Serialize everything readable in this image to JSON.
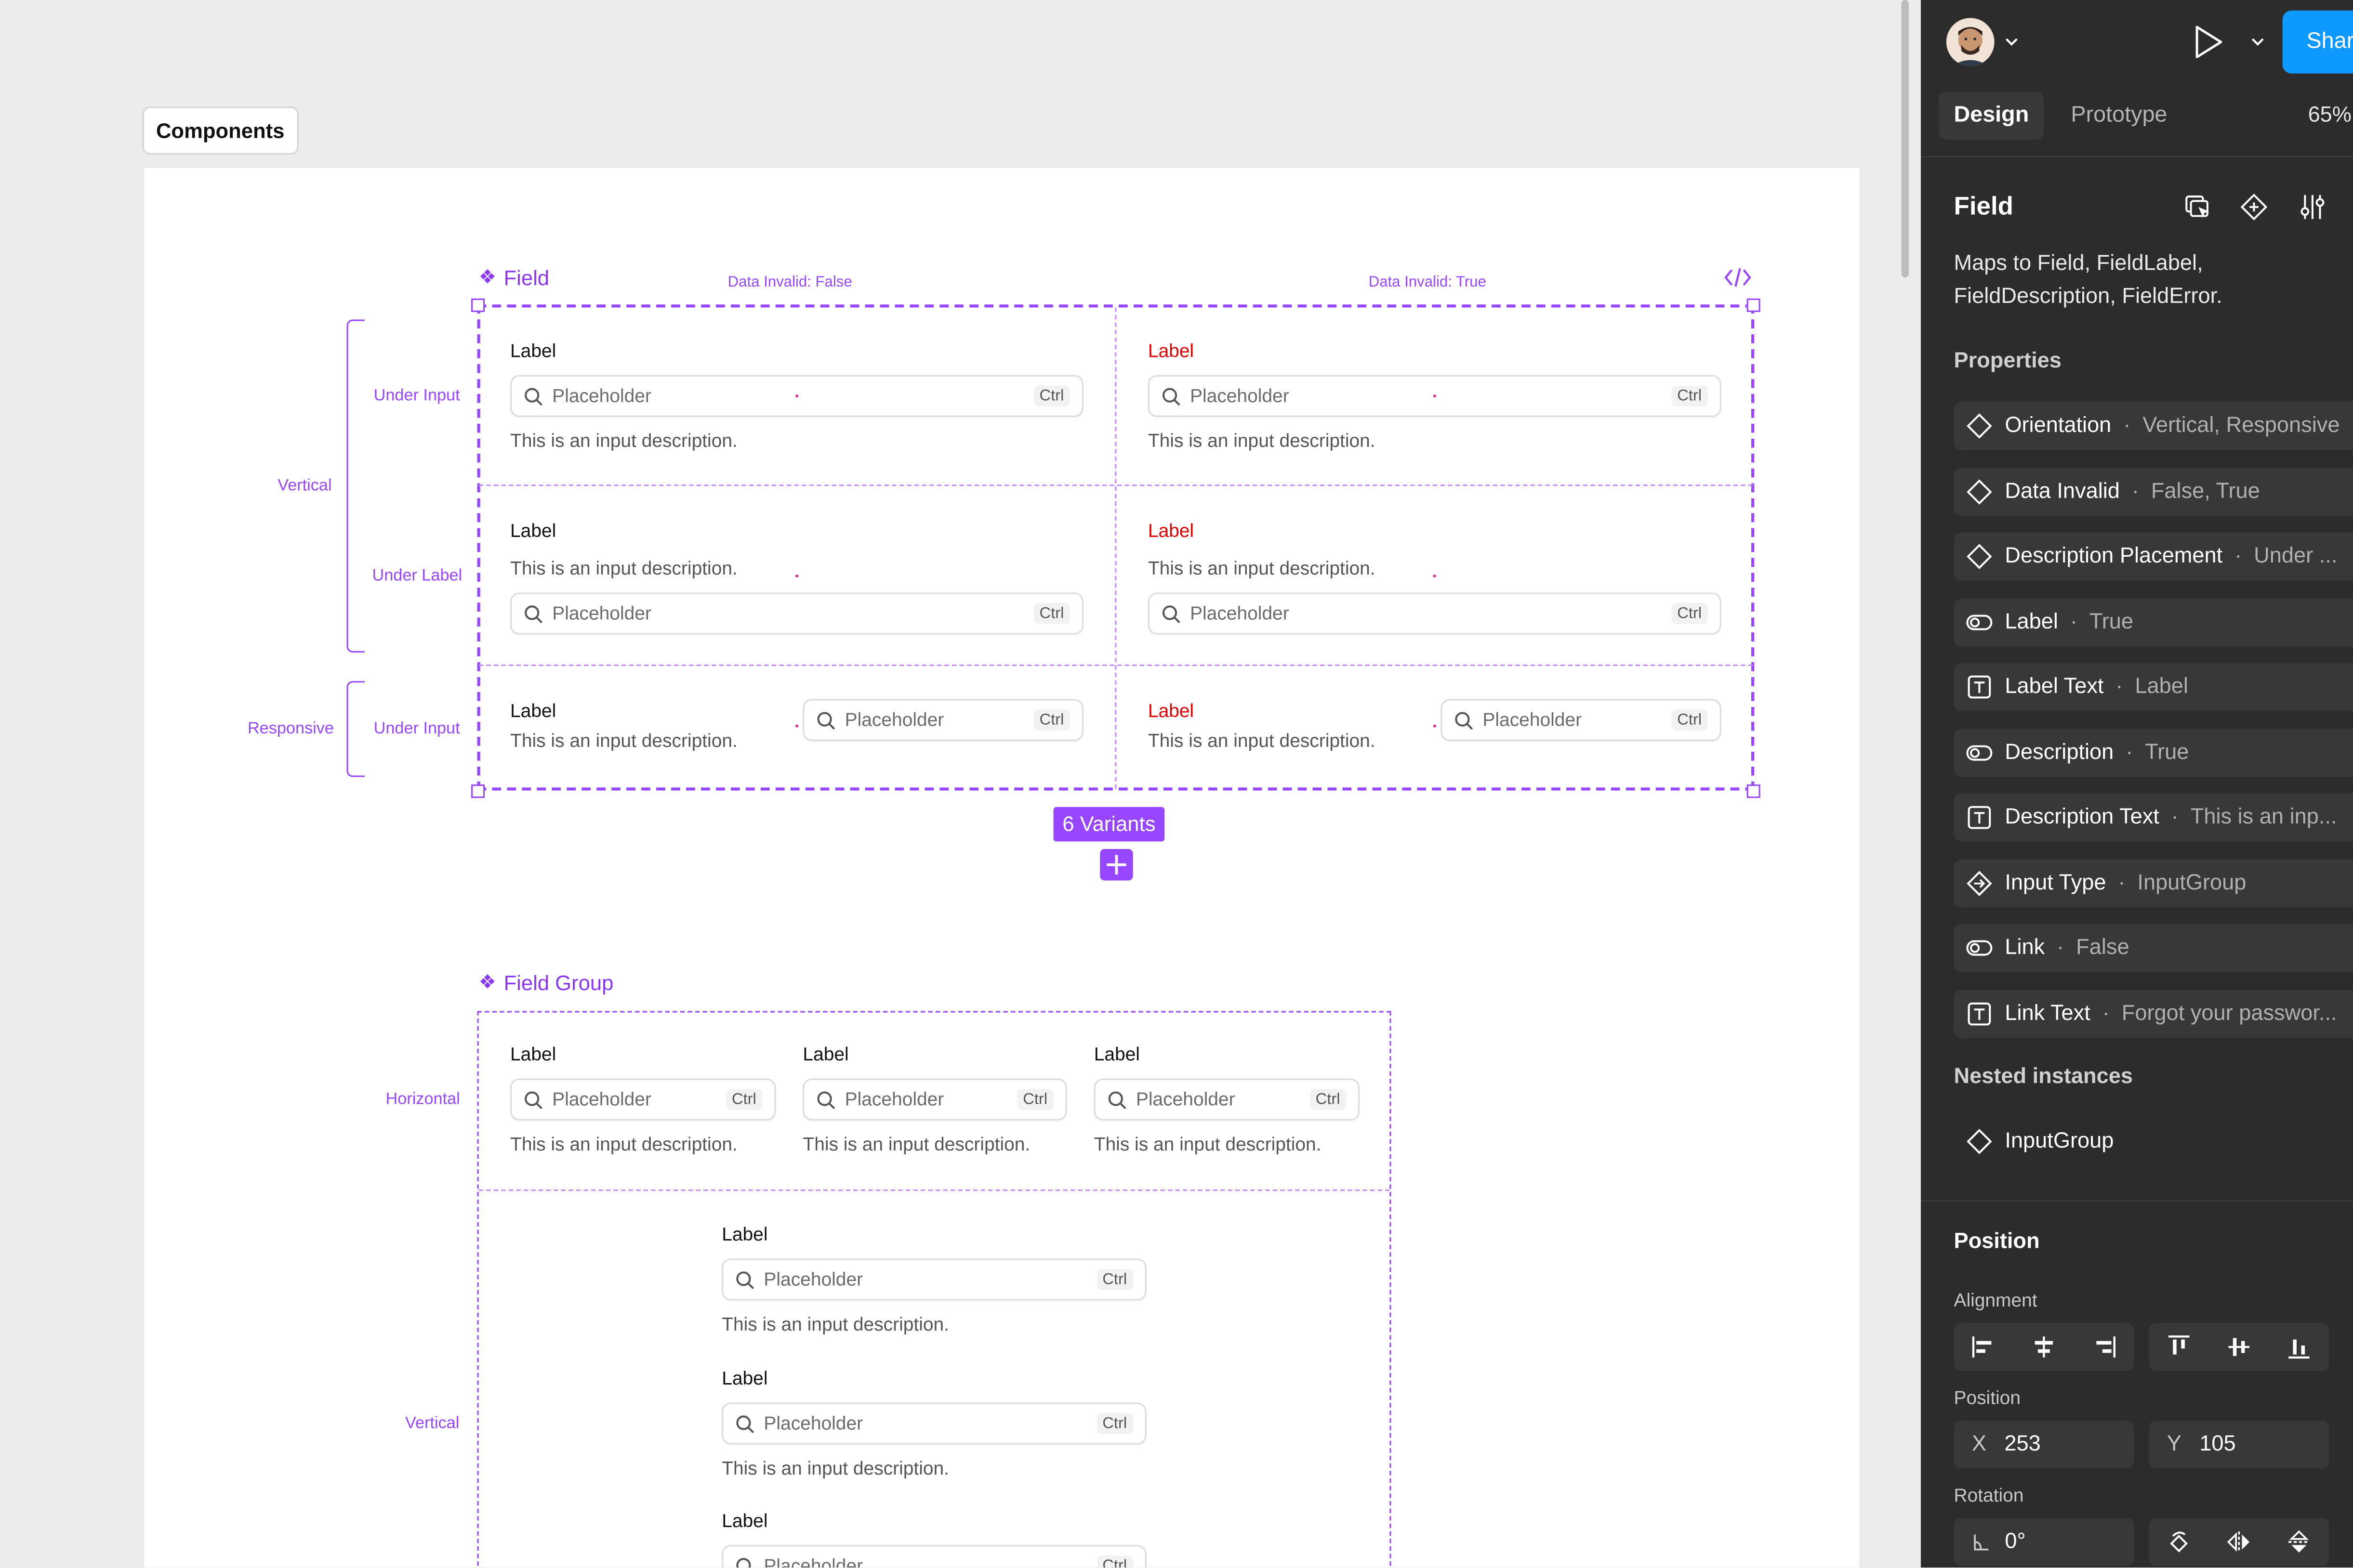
{
  "canvas": {
    "frame_tag": "Components",
    "field_component": {
      "title": "Field",
      "col_headers": [
        "Data Invalid: False",
        "Data Invalid: True"
      ],
      "variants_badge": "6 Variants",
      "side_labels": {
        "vertical": "Vertical",
        "responsive": "Responsive",
        "under_input_1": "Under Input",
        "under_label": "Under Label",
        "under_input_2": "Under Input"
      },
      "label_text": "Label",
      "placeholder": "Placeholder",
      "kbd": "Ctrl",
      "description": "This is an input description."
    },
    "field_group_component": {
      "title": "Field Group",
      "side_labels": {
        "horizontal": "Horizontal",
        "vertical": "Vertical"
      },
      "label_text": "Label",
      "placeholder": "Placeholder",
      "kbd": "Ctrl",
      "description": "This is an input description."
    }
  },
  "panel": {
    "tabs": [
      "Design",
      "Prototype"
    ],
    "zoom": "65%",
    "share_label": "Share",
    "component_name": "Field",
    "component_description": "Maps to Field, FieldLabel, FieldDescription, FieldError.",
    "properties_heading": "Properties",
    "properties": [
      {
        "icon": "variant-icon",
        "name": "Orientation",
        "value": "Vertical, Responsive"
      },
      {
        "icon": "variant-icon",
        "name": "Data Invalid",
        "value": "False, True"
      },
      {
        "icon": "variant-icon",
        "name": "Description Placement",
        "value": "Under ..."
      },
      {
        "icon": "boolean-icon",
        "name": "Label",
        "value": "True"
      },
      {
        "icon": "text-icon",
        "name": "Label Text",
        "value": "Label"
      },
      {
        "icon": "boolean-icon",
        "name": "Description",
        "value": "True"
      },
      {
        "icon": "text-icon",
        "name": "Description Text",
        "value": "This is an inp..."
      },
      {
        "icon": "instance-swap-icon",
        "name": "Input Type",
        "value": "InputGroup"
      },
      {
        "icon": "boolean-icon",
        "name": "Link",
        "value": "False"
      },
      {
        "icon": "text-icon",
        "name": "Link Text",
        "value": "Forgot your passwor..."
      }
    ],
    "nested_heading": "Nested instances",
    "nested_item": "InputGroup",
    "position_heading": "Position",
    "alignment_label": "Alignment",
    "position_label": "Position",
    "x_axis": "X",
    "x_value": "253",
    "y_axis": "Y",
    "y_value": "105",
    "rotation_label": "Rotation",
    "rotation_value": "0°",
    "accent_color": "#9747ff",
    "share_color": "#0d99ff",
    "error_color": "#e00000"
  }
}
